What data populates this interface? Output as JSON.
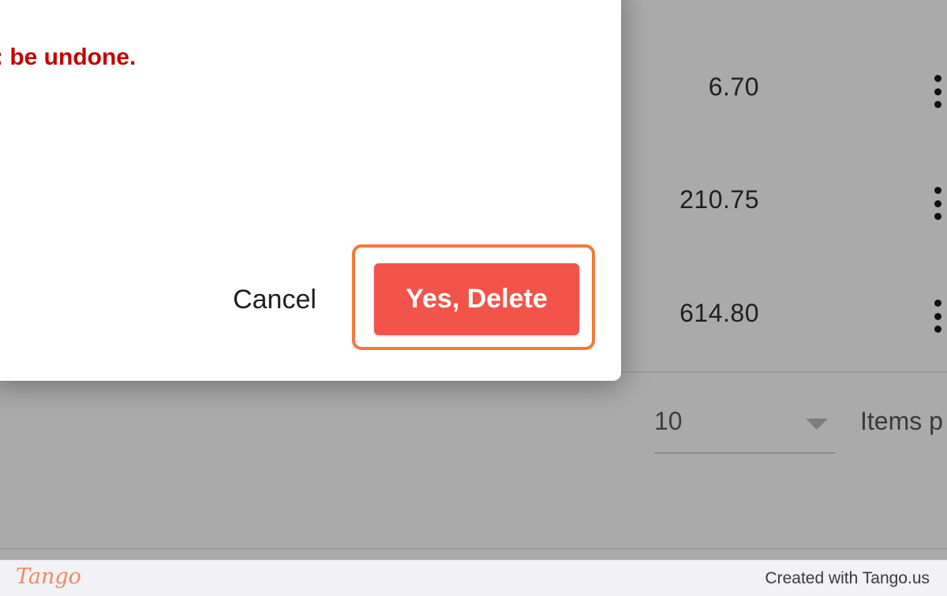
{
  "background_table": {
    "rows": [
      {
        "value": "6.70"
      },
      {
        "value": "210.75"
      },
      {
        "value": "614.80"
      }
    ],
    "row_menu_icon": "kebab-menu-icon",
    "pagination": {
      "per_page_value": "10",
      "per_page_dropdown_icon": "caret-down-icon",
      "items_per_page_label": "Items p"
    }
  },
  "dialog": {
    "warning_text": ": be undone.",
    "cancel_label": "Cancel",
    "confirm_label": "Yes, Delete"
  },
  "colors": {
    "warning": "#c30000",
    "confirm_button": "#f2544a",
    "highlight_frame": "#f17a3b",
    "overlay": "#aaaaaa"
  },
  "footer": {
    "logo_text": "Tango",
    "credit_text": "Created with Tango.us"
  }
}
